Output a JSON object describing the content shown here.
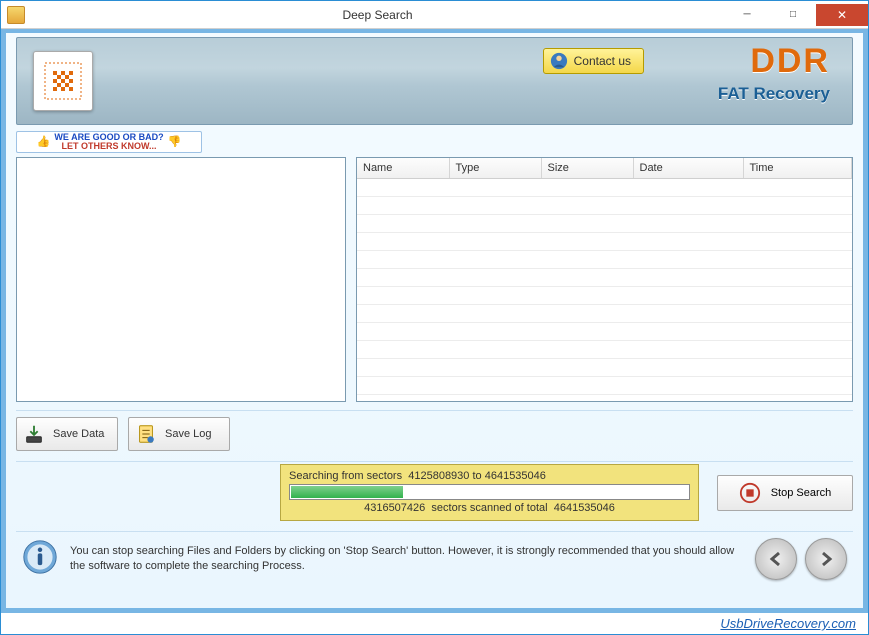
{
  "window": {
    "title": "Deep Search"
  },
  "banner": {
    "contact_label": "Contact us",
    "brand_title": "DDR",
    "brand_subtitle": "FAT Recovery"
  },
  "feedback": {
    "line1": "WE ARE GOOD OR BAD?",
    "line2": "LET OTHERS KNOW..."
  },
  "table": {
    "columns": [
      "Name",
      "Type",
      "Size",
      "Date",
      "Time"
    ]
  },
  "buttons": {
    "save_data": "Save Data",
    "save_log": "Save Log",
    "stop_search": "Stop Search"
  },
  "progress": {
    "line1_prefix": "Searching from sectors",
    "from_sector": "4125808930",
    "to_sector": "4641535046",
    "scanned": "4316507426",
    "total": "4641535046",
    "scanned_suffix": "sectors scanned of total"
  },
  "info": {
    "text": "You can stop searching Files and Folders by clicking on 'Stop Search' button. However, it is strongly recommended that you should allow the software to complete the searching Process."
  },
  "footer": {
    "link_text": "UsbDriveRecovery.com"
  }
}
